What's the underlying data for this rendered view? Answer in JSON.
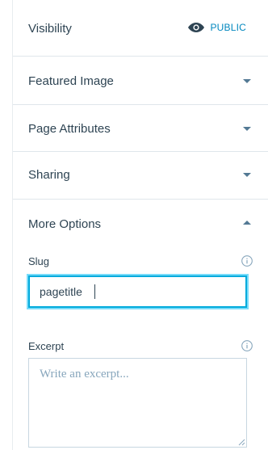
{
  "visibility": {
    "label": "Visibility",
    "value": "PUBLIC",
    "icon": "eye-icon"
  },
  "sections": {
    "featured_image": "Featured Image",
    "page_attributes": "Page Attributes",
    "sharing": "Sharing",
    "more_options": "More Options"
  },
  "more_options": {
    "slug_label": "Slug",
    "slug_value": "pagetitle",
    "excerpt_label": "Excerpt",
    "excerpt_placeholder": "Write an excerpt..."
  },
  "colors": {
    "accent": "#0087be",
    "focus_border": "#00aadc",
    "text": "#2e4453",
    "caret": "#537994",
    "placeholder": "#87a6bc"
  }
}
